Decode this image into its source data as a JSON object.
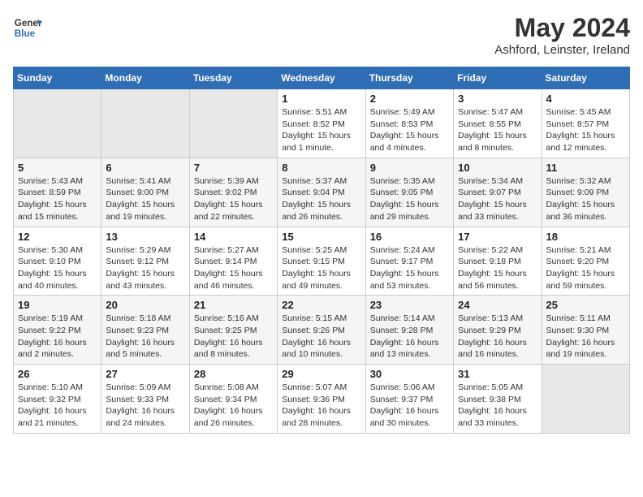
{
  "header": {
    "logo_line1": "General",
    "logo_line2": "Blue",
    "title": "May 2024",
    "subtitle": "Ashford, Leinster, Ireland"
  },
  "weekdays": [
    "Sunday",
    "Monday",
    "Tuesday",
    "Wednesday",
    "Thursday",
    "Friday",
    "Saturday"
  ],
  "weeks": [
    [
      {
        "day": "",
        "info": ""
      },
      {
        "day": "",
        "info": ""
      },
      {
        "day": "",
        "info": ""
      },
      {
        "day": "1",
        "info": "Sunrise: 5:51 AM\nSunset: 8:52 PM\nDaylight: 15 hours\nand 1 minute."
      },
      {
        "day": "2",
        "info": "Sunrise: 5:49 AM\nSunset: 8:53 PM\nDaylight: 15 hours\nand 4 minutes."
      },
      {
        "day": "3",
        "info": "Sunrise: 5:47 AM\nSunset: 8:55 PM\nDaylight: 15 hours\nand 8 minutes."
      },
      {
        "day": "4",
        "info": "Sunrise: 5:45 AM\nSunset: 8:57 PM\nDaylight: 15 hours\nand 12 minutes."
      }
    ],
    [
      {
        "day": "5",
        "info": "Sunrise: 5:43 AM\nSunset: 8:59 PM\nDaylight: 15 hours\nand 15 minutes."
      },
      {
        "day": "6",
        "info": "Sunrise: 5:41 AM\nSunset: 9:00 PM\nDaylight: 15 hours\nand 19 minutes."
      },
      {
        "day": "7",
        "info": "Sunrise: 5:39 AM\nSunset: 9:02 PM\nDaylight: 15 hours\nand 22 minutes."
      },
      {
        "day": "8",
        "info": "Sunrise: 5:37 AM\nSunset: 9:04 PM\nDaylight: 15 hours\nand 26 minutes."
      },
      {
        "day": "9",
        "info": "Sunrise: 5:35 AM\nSunset: 9:05 PM\nDaylight: 15 hours\nand 29 minutes."
      },
      {
        "day": "10",
        "info": "Sunrise: 5:34 AM\nSunset: 9:07 PM\nDaylight: 15 hours\nand 33 minutes."
      },
      {
        "day": "11",
        "info": "Sunrise: 5:32 AM\nSunset: 9:09 PM\nDaylight: 15 hours\nand 36 minutes."
      }
    ],
    [
      {
        "day": "12",
        "info": "Sunrise: 5:30 AM\nSunset: 9:10 PM\nDaylight: 15 hours\nand 40 minutes."
      },
      {
        "day": "13",
        "info": "Sunrise: 5:29 AM\nSunset: 9:12 PM\nDaylight: 15 hours\nand 43 minutes."
      },
      {
        "day": "14",
        "info": "Sunrise: 5:27 AM\nSunset: 9:14 PM\nDaylight: 15 hours\nand 46 minutes."
      },
      {
        "day": "15",
        "info": "Sunrise: 5:25 AM\nSunset: 9:15 PM\nDaylight: 15 hours\nand 49 minutes."
      },
      {
        "day": "16",
        "info": "Sunrise: 5:24 AM\nSunset: 9:17 PM\nDaylight: 15 hours\nand 53 minutes."
      },
      {
        "day": "17",
        "info": "Sunrise: 5:22 AM\nSunset: 9:18 PM\nDaylight: 15 hours\nand 56 minutes."
      },
      {
        "day": "18",
        "info": "Sunrise: 5:21 AM\nSunset: 9:20 PM\nDaylight: 15 hours\nand 59 minutes."
      }
    ],
    [
      {
        "day": "19",
        "info": "Sunrise: 5:19 AM\nSunset: 9:22 PM\nDaylight: 16 hours\nand 2 minutes."
      },
      {
        "day": "20",
        "info": "Sunrise: 5:18 AM\nSunset: 9:23 PM\nDaylight: 16 hours\nand 5 minutes."
      },
      {
        "day": "21",
        "info": "Sunrise: 5:16 AM\nSunset: 9:25 PM\nDaylight: 16 hours\nand 8 minutes."
      },
      {
        "day": "22",
        "info": "Sunrise: 5:15 AM\nSunset: 9:26 PM\nDaylight: 16 hours\nand 10 minutes."
      },
      {
        "day": "23",
        "info": "Sunrise: 5:14 AM\nSunset: 9:28 PM\nDaylight: 16 hours\nand 13 minutes."
      },
      {
        "day": "24",
        "info": "Sunrise: 5:13 AM\nSunset: 9:29 PM\nDaylight: 16 hours\nand 16 minutes."
      },
      {
        "day": "25",
        "info": "Sunrise: 5:11 AM\nSunset: 9:30 PM\nDaylight: 16 hours\nand 19 minutes."
      }
    ],
    [
      {
        "day": "26",
        "info": "Sunrise: 5:10 AM\nSunset: 9:32 PM\nDaylight: 16 hours\nand 21 minutes."
      },
      {
        "day": "27",
        "info": "Sunrise: 5:09 AM\nSunset: 9:33 PM\nDaylight: 16 hours\nand 24 minutes."
      },
      {
        "day": "28",
        "info": "Sunrise: 5:08 AM\nSunset: 9:34 PM\nDaylight: 16 hours\nand 26 minutes."
      },
      {
        "day": "29",
        "info": "Sunrise: 5:07 AM\nSunset: 9:36 PM\nDaylight: 16 hours\nand 28 minutes."
      },
      {
        "day": "30",
        "info": "Sunrise: 5:06 AM\nSunset: 9:37 PM\nDaylight: 16 hours\nand 30 minutes."
      },
      {
        "day": "31",
        "info": "Sunrise: 5:05 AM\nSunset: 9:38 PM\nDaylight: 16 hours\nand 33 minutes."
      },
      {
        "day": "",
        "info": ""
      }
    ]
  ]
}
